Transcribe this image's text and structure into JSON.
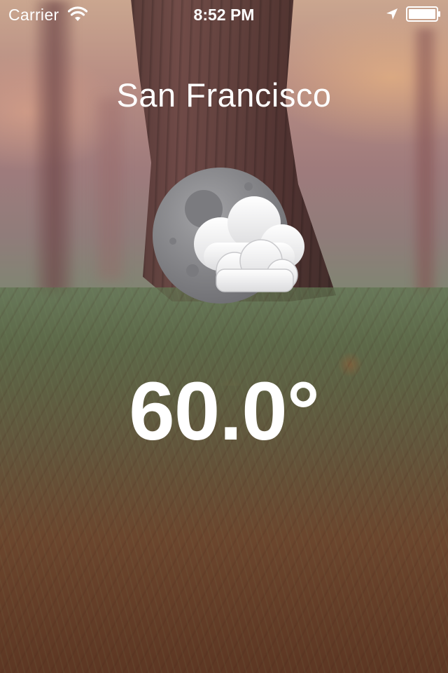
{
  "status_bar": {
    "carrier": "Carrier",
    "time": "8:52 PM",
    "icons": [
      "wifi-icon",
      "location-arrow-icon",
      "battery-icon"
    ]
  },
  "weather": {
    "city": "San Francisco",
    "condition_icon": "moon-cloudy-icon",
    "temperature": "60.0°"
  },
  "colors": {
    "text": "#ffffff",
    "moon": "#8a8a8e",
    "cloud": "#f2f2f2"
  }
}
